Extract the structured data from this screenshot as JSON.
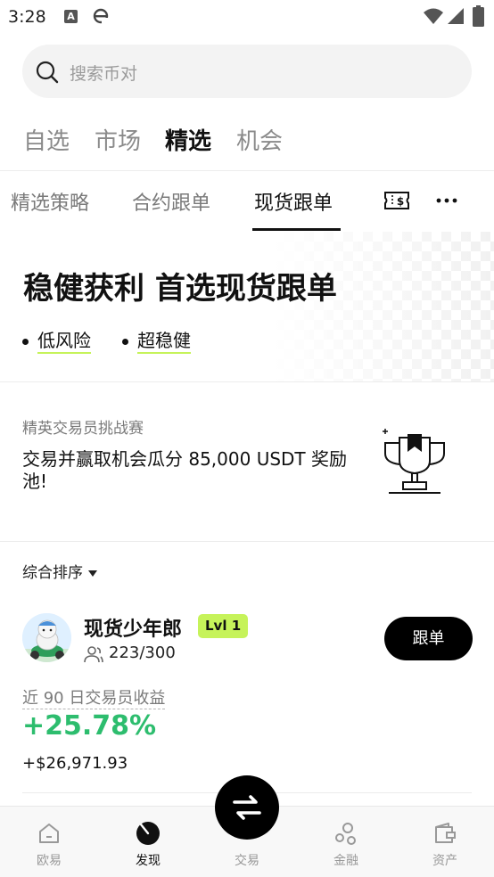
{
  "status_bar": {
    "time": "3:28",
    "badge_letter": "A"
  },
  "search": {
    "placeholder": "搜索币对"
  },
  "top_tabs": [
    {
      "label": "自选",
      "active": false
    },
    {
      "label": "市场",
      "active": false
    },
    {
      "label": "精选",
      "active": true
    },
    {
      "label": "机会",
      "active": false
    }
  ],
  "sub_tabs": [
    {
      "label": "精选策略",
      "active": false
    },
    {
      "label": "合约跟单",
      "active": false
    },
    {
      "label": "现货跟单",
      "active": true
    }
  ],
  "hero": {
    "title": "稳健获利 首选现货跟单",
    "tags": [
      "低风险",
      "超稳健"
    ]
  },
  "promo": {
    "eyebrow": "精英交易员挑战赛",
    "text": "交易并赢取机会瓜分 85,000 USDT 奖励池!"
  },
  "sort": {
    "label": "综合排序"
  },
  "trader": {
    "name": "现货少年郎",
    "level": "Lvl 1",
    "followers": "223/300",
    "follow_label": "跟单",
    "pnl_label": "近 90 日交易员收益",
    "pnl_percent": "+25.78%",
    "pnl_amount": "+$26,971.93"
  },
  "bottom_nav": [
    {
      "label": "欧易",
      "icon": "home-icon",
      "active": false
    },
    {
      "label": "发现",
      "icon": "discover-icon",
      "active": true
    },
    {
      "label": "交易",
      "icon": "trade-icon",
      "active": false
    },
    {
      "label": "金融",
      "icon": "finance-icon",
      "active": false
    },
    {
      "label": "资产",
      "icon": "wallet-icon",
      "active": false
    }
  ],
  "colors": {
    "accent_green": "#2dbd6e",
    "tag_lime": "#c6f35a",
    "primary_black": "#000000",
    "muted_text": "#8a8a8a"
  }
}
